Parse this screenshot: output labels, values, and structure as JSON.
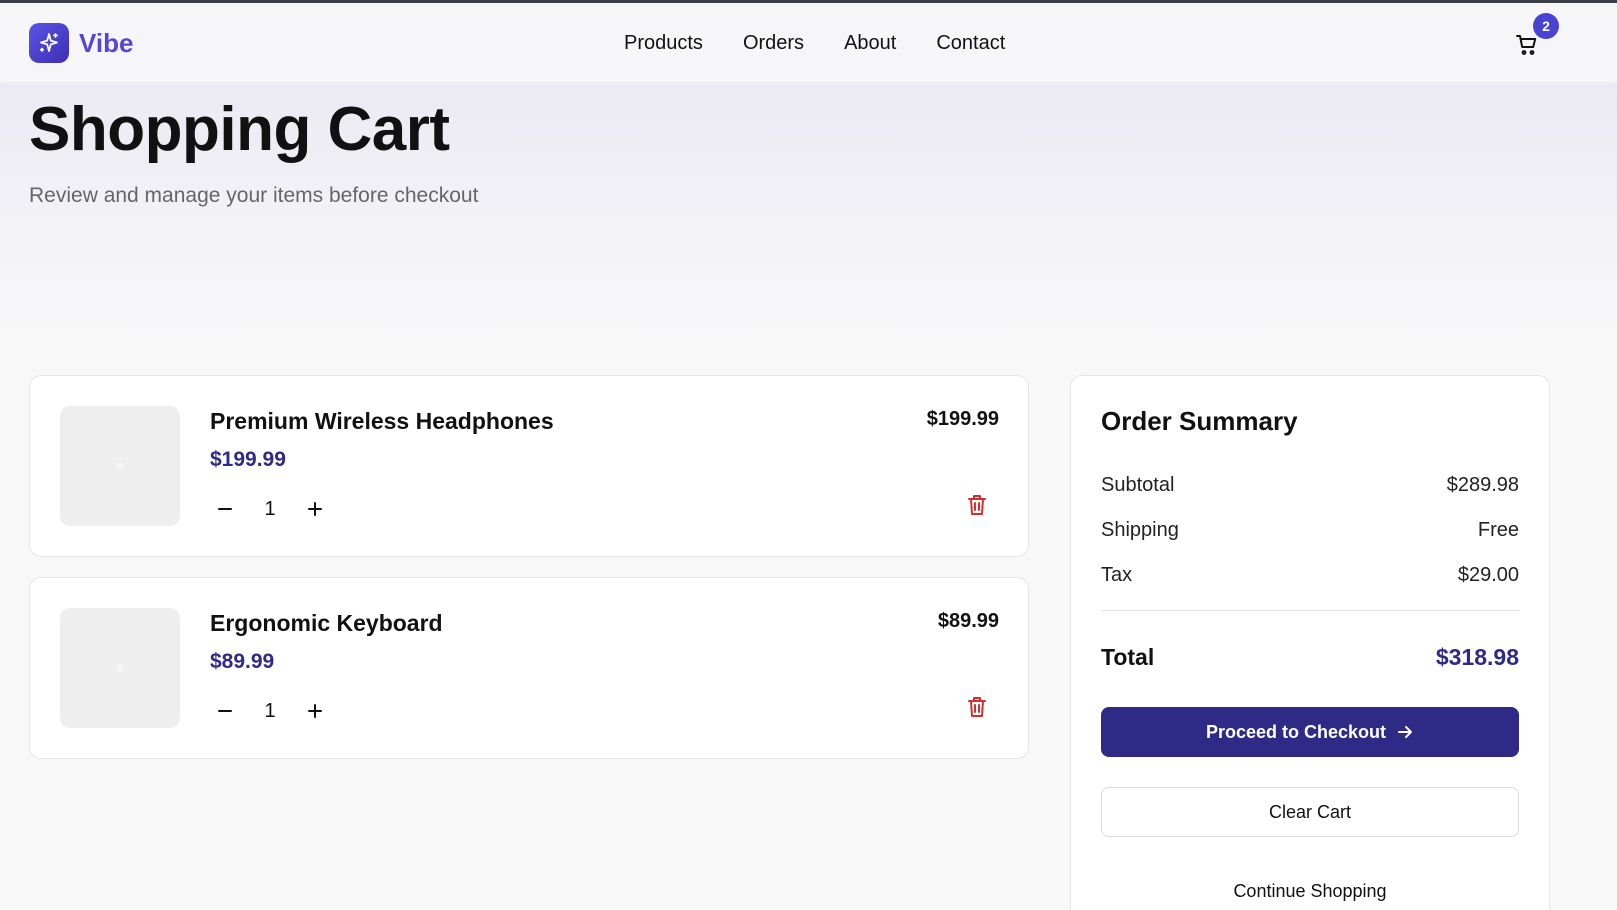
{
  "header": {
    "brand": "Vibe",
    "nav": [
      "Products",
      "Orders",
      "About",
      "Contact"
    ],
    "cart_count": "2",
    "brand_color": "#5547d6"
  },
  "hero": {
    "title": "Shopping Cart",
    "subtitle": "Review and manage your items before checkout"
  },
  "cart": {
    "items": [
      {
        "name": "Premium Wireless Headphones",
        "unit_price": "$199.99",
        "quantity": "1",
        "line_total": "$199.99"
      },
      {
        "name": "Ergonomic Keyboard",
        "unit_price": "$89.99",
        "quantity": "1",
        "line_total": "$89.99"
      }
    ]
  },
  "summary": {
    "title": "Order Summary",
    "subtotal_label": "Subtotal",
    "subtotal": "$289.98",
    "shipping_label": "Shipping",
    "shipping": "Free",
    "tax_label": "Tax",
    "tax": "$29.00",
    "total_label": "Total",
    "total": "$318.98",
    "checkout_label": "Proceed to Checkout",
    "clear_label": "Clear Cart",
    "continue_label": "Continue Shopping"
  },
  "colors": {
    "accent": "#2f2a86",
    "danger": "#d32f2f",
    "badge": "#4a42d0"
  },
  "icons": {
    "logo": "sparkle-icon",
    "cart": "cart-icon",
    "delete": "trash-icon",
    "checkout_arrow": "arrow-right-icon"
  }
}
